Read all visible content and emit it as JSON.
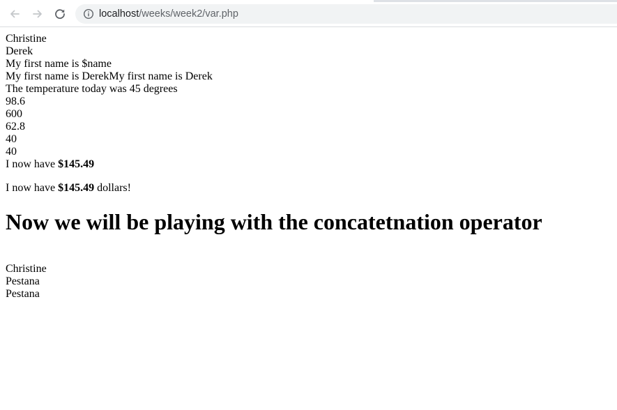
{
  "browser": {
    "url_host": "localhost",
    "url_path": "/weeks/week2/var.php",
    "icons": {
      "back": "arrow-left-icon",
      "forward": "arrow-right-icon",
      "reload": "reload-icon",
      "site_info": "info-icon"
    }
  },
  "page": {
    "lines": [
      "Christine",
      "Derek",
      "My first name is $name",
      "My first name is DerekMy first name is Derek",
      "The temperature today was 45 degrees",
      "98.6",
      "600",
      "62.8",
      "40",
      "40"
    ],
    "money_line": {
      "prefix": "I now have ",
      "amount": "$145.49"
    },
    "money_paragraph": {
      "prefix": "I now have ",
      "amount": "$145.49",
      "suffix": " dollars!"
    },
    "heading": "Now we will be playing with the concatetnation operator",
    "final_lines": [
      "Christine",
      "Pestana",
      "Pestana"
    ]
  }
}
